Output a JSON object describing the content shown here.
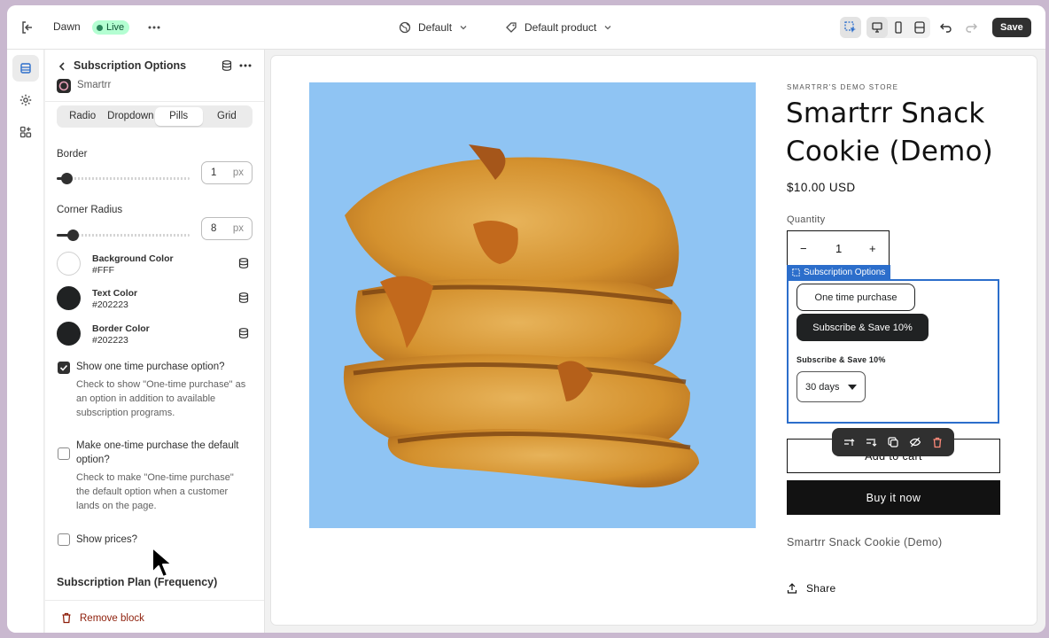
{
  "topbar": {
    "theme_name": "Dawn",
    "status_badge": "Live",
    "template_selector": "Default",
    "product_selector": "Default product",
    "save_label": "Save"
  },
  "panel": {
    "title": "Subscription Options",
    "app_name": "Smartrr",
    "layout_tabs": [
      {
        "label": "Radio",
        "selected": false
      },
      {
        "label": "Dropdown",
        "selected": false
      },
      {
        "label": "Pills",
        "selected": true
      },
      {
        "label": "Grid",
        "selected": false
      }
    ],
    "border": {
      "label": "Border",
      "value": "1",
      "unit": "px",
      "slider_fraction": 0.07
    },
    "corner_radius": {
      "label": "Corner Radius",
      "value": "8",
      "unit": "px",
      "slider_fraction": 0.12
    },
    "colors": [
      {
        "label": "Background Color",
        "value": "#FFF",
        "swatch": "#ffffff"
      },
      {
        "label": "Text Color",
        "value": "#202223",
        "swatch": "#202223"
      },
      {
        "label": "Border Color",
        "value": "#202223",
        "swatch": "#202223"
      }
    ],
    "options": [
      {
        "label": "Show one time purchase option?",
        "checked": true,
        "help": "Check to show \"One-time purchase\" as an option in addition to available subscription programs."
      },
      {
        "label": "Make one-time purchase the default option?",
        "checked": false,
        "help": "Check to make \"One-time purchase\" the default option when a customer lands on the page."
      },
      {
        "label": "Show prices?",
        "checked": false,
        "help": ""
      }
    ],
    "section_title": "Subscription Plan (Frequency)",
    "remove_label": "Remove block"
  },
  "preview": {
    "store_name": "SMARTRR'S DEMO STORE",
    "product_title": "Smartrr Snack Cookie (Demo)",
    "price": "$10.00 USD",
    "quantity_label": "Quantity",
    "quantity_value": "1",
    "quantity_minus": "−",
    "quantity_plus": "+",
    "block_tag": "Subscription Options",
    "purchase_options": [
      {
        "label": "One time purchase",
        "selected": false
      },
      {
        "label": "Subscribe & Save 10%",
        "selected": true
      }
    ],
    "plan_heading": "Subscribe & Save 10%",
    "frequency": "30 days",
    "add_to_cart": "Add to cart",
    "buy_now": "Buy it now",
    "description": "Smartrr Snack Cookie (Demo)",
    "share": "Share"
  },
  "colors": {
    "accent_selection": "#2c6ecb",
    "live_badge": "#b4fed2",
    "destructive": "#8e1f0b",
    "image_background": "#8fc4f3"
  }
}
